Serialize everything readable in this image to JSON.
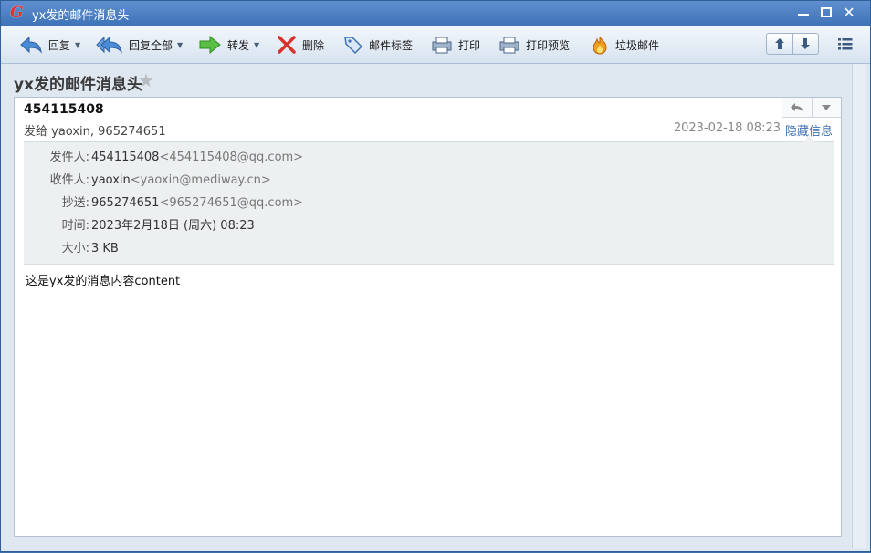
{
  "window": {
    "title": "yx发的邮件消息头"
  },
  "toolbar": {
    "reply": "回复",
    "reply_all": "回复全部",
    "forward": "转发",
    "delete": "删除",
    "tag": "邮件标签",
    "print": "打印",
    "print_preview": "打印预览",
    "spam": "垃圾邮件"
  },
  "subject": "yx发的邮件消息头",
  "message": {
    "sender_display": "454115408",
    "sent_to": "发给 yaoxin, 965274651",
    "datetime": "2023-02-18 08:23",
    "hide_info": "隐藏信息",
    "details": {
      "from_label": "发件人:",
      "from_name": "454115408",
      "from_addr": "<454115408@qq.com>",
      "to_label": "收件人:",
      "to_name": "yaoxin",
      "to_addr": "<yaoxin@mediway.cn>",
      "cc_label": "抄送:",
      "cc_name": "965274651",
      "cc_addr": "<965274651@qq.com>",
      "time_label": "时间:",
      "time_value": "2023年2月18日 (周六) 08:23",
      "size_label": "大小:",
      "size_value": "3 KB"
    },
    "body": "这是yx发的消息内容content"
  }
}
